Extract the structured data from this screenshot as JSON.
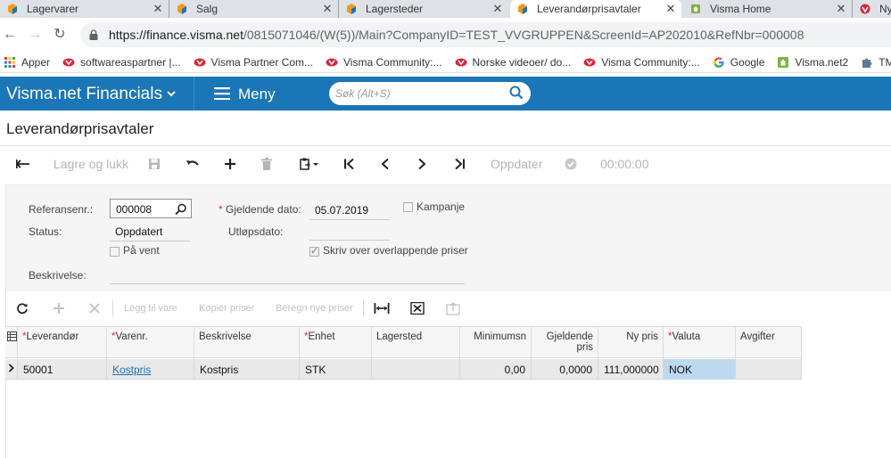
{
  "browser": {
    "tabs": [
      {
        "title": "Lagervarer",
        "active": false
      },
      {
        "title": "Salg",
        "active": false
      },
      {
        "title": "Lagersteder",
        "active": false
      },
      {
        "title": "Leverandørprisavtaler",
        "active": true
      },
      {
        "title": "Visma Home",
        "active": false
      },
      {
        "title": "Ny",
        "active": false
      }
    ],
    "url_host": "https://finance.visma.net",
    "url_path": "/0815071046/(W(5))/Main?CompanyID=TEST_VVGRUPPEN&ScreenId=AP202010&RefNbr=000008",
    "bookmarks": [
      {
        "label": "Apper",
        "icon": "apps-grid-icon"
      },
      {
        "label": "softwareaspartner |...",
        "icon": "visma-red-icon"
      },
      {
        "label": "Visma Partner Com...",
        "icon": "visma-red-icon"
      },
      {
        "label": "Visma Community:...",
        "icon": "visma-red-icon"
      },
      {
        "label": "Norske videoer/ do...",
        "icon": "visma-red-icon"
      },
      {
        "label": "Visma Community:...",
        "icon": "visma-red-icon"
      },
      {
        "label": "Google",
        "icon": "google-icon"
      },
      {
        "label": "Visma.net2",
        "icon": "visma-home-icon"
      },
      {
        "label": "TMS Logg",
        "icon": "puzzle-icon"
      }
    ]
  },
  "app": {
    "brand": "Visma.net Financials",
    "menu_label": "Meny",
    "search_placeholder": "Søk (Alt+S)",
    "colors": {
      "appbar": "#1a76b6",
      "link": "#1a6fb0",
      "selected_cell": "#bcd9f0",
      "required": "#c0392b"
    }
  },
  "page": {
    "title": "Leverandørprisavtaler"
  },
  "toolbar": {
    "save_close": "Lagre og lukk",
    "update": "Oppdater",
    "timer": "00:00:00"
  },
  "form": {
    "ref_label": "Referansenr.:",
    "ref_value": "000008",
    "status_label": "Status:",
    "status_value": "Oppdatert",
    "on_hold_label": "På vent",
    "on_hold_checked": false,
    "effective_date_label": "Gjeldende dato:",
    "effective_date_value": "05.07.2019",
    "expiry_label": "Utløpsdato:",
    "expiry_value": "",
    "campaign_label": "Kampanje",
    "campaign_checked": false,
    "overwrite_label": "Skriv over overlappende priser",
    "overwrite_checked": true,
    "description_label": "Beskrivelse:",
    "description_value": ""
  },
  "grid_toolbar": {
    "add_item": "Legg til vare",
    "copy_prices": "Kopier priser",
    "calc_prices": "Beregn nye priser"
  },
  "grid": {
    "columns": [
      {
        "key": "vendor",
        "label": "Leverandør",
        "required": true
      },
      {
        "key": "item",
        "label": "Varenr.",
        "required": true
      },
      {
        "key": "desc",
        "label": "Beskrivelse",
        "required": false
      },
      {
        "key": "uom",
        "label": "Enhet",
        "required": true
      },
      {
        "key": "warehouse",
        "label": "Lagersted",
        "required": false
      },
      {
        "key": "min",
        "label": "Minimumsn",
        "required": false
      },
      {
        "key": "curprice",
        "label": "Gjeldende pris",
        "required": false
      },
      {
        "key": "newprice",
        "label": "Ny pris",
        "required": false
      },
      {
        "key": "currency",
        "label": "Valuta",
        "required": true
      },
      {
        "key": "fees",
        "label": "Avgifter",
        "required": false
      }
    ],
    "rows": [
      {
        "vendor": "50001",
        "item": "Kostpris",
        "desc": "Kostpris",
        "uom": "STK",
        "warehouse": "",
        "min": "0,00",
        "curprice": "0,0000",
        "newprice": "111,000000",
        "currency": "NOK",
        "fees": ""
      }
    ]
  }
}
